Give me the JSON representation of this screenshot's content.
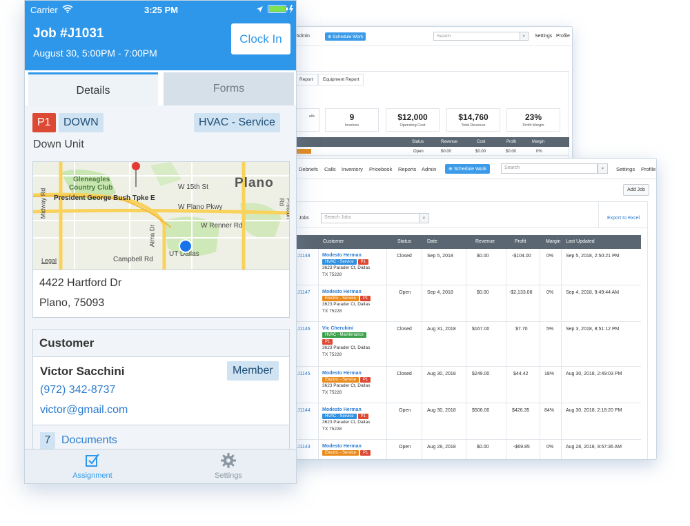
{
  "phone": {
    "status_bar": {
      "carrier": "Carrier",
      "time": "3:25 PM"
    },
    "job": {
      "title": "Job #J1031",
      "time": "August 30, 5:00PM - 7:00PM"
    },
    "clock_in_label": "Clock In",
    "tabs": [
      {
        "label": "Details",
        "active": true
      },
      {
        "label": "Forms",
        "active": false
      }
    ],
    "badges": {
      "priority": "P1",
      "state": "DOWN",
      "service": "HVAC - Service"
    },
    "summary": "Down Unit",
    "map": {
      "labels": {
        "gleneagles": "Gleneagles",
        "country_club": "Country Club",
        "w15": "W 15th St",
        "plano": "Plano",
        "bush": "President George Bush Tpke E",
        "wplano": "W Plano Pkwy",
        "renner": "W Renner Rd",
        "campbell": "Campbell Rd",
        "utd": "UT Dallas",
        "midway": "Midway Rd",
        "preston": "Preston Rd",
        "alma": "Alma Dr",
        "legal": "Legal"
      }
    },
    "address": {
      "line1": "4422 Hartford Dr",
      "line2": "Plano, 75093"
    },
    "customer": {
      "heading": "Customer",
      "name": "Victor Sacchini",
      "tag": "Member",
      "phone": "(972) 342-8737",
      "email": "victor@gmail.com",
      "documents_count": "7",
      "documents_label": "Documents"
    },
    "tabbar": [
      {
        "label": "Assignment",
        "icon": "checkbox-icon",
        "active": true
      },
      {
        "label": "Settings",
        "icon": "gear-icon",
        "active": false
      }
    ]
  },
  "back_window": {
    "nav": {
      "admin": "Admin",
      "schedule": "Schedule Work",
      "search_placeholder": "Search",
      "settings": "Settings",
      "profile": "Profile"
    },
    "tabs": [
      "Report",
      "Equipment Report"
    ],
    "stats": [
      {
        "value": "",
        "label": "alls"
      },
      {
        "value": "9",
        "label": "Invoices"
      },
      {
        "value": "$12,000",
        "label": "Operating Cost"
      },
      {
        "value": "$14,760",
        "label": "Total Revenue"
      },
      {
        "value": "23%",
        "label": "Profit Margin"
      }
    ],
    "headers": [
      "Status",
      "Revenue",
      "Cost",
      "Profit",
      "Margin"
    ],
    "row": [
      "Open",
      "$0.00",
      "$0.00",
      "$0.00",
      "0%"
    ]
  },
  "front_window": {
    "nav": {
      "debriefs": "Debriefs",
      "calls": "Calls",
      "inventory": "Inventory",
      "pricebook": "Pricebook",
      "reports": "Reports",
      "admin": "Admin",
      "schedule": "Schedule Work",
      "search_placeholder": "Search",
      "settings": "Settings",
      "profile": "Profile"
    },
    "add_job": "Add Job",
    "jobs_label": "Jobs",
    "search_jobs_placeholder": "Search Jobs",
    "export": "Export to Excel",
    "headers": [
      "Customer",
      "Status",
      "Date",
      "Revenue",
      "Profit",
      "Margin",
      "Last Updated"
    ],
    "rows": [
      {
        "id": "J1148",
        "customer": "Modesto Herman",
        "tags": [
          {
            "text": "HVAC - Service",
            "color": "#2f8fe0"
          },
          {
            "text": "P1",
            "color": "#dc4a36"
          }
        ],
        "addr1": "3623 Parader Ct, Dallas",
        "addr2": "TX 75228",
        "status": "Closed",
        "date": "Sep 5, 2018",
        "revenue": "$0.00",
        "profit": "-$104.00",
        "margin": "0%",
        "updated": "Sep 5, 2018, 2:50:21 PM"
      },
      {
        "id": "J1147",
        "customer": "Modesto Herman",
        "tags": [
          {
            "text": "Electric - Service",
            "color": "#e98a1a"
          },
          {
            "text": "P1",
            "color": "#dc4a36"
          }
        ],
        "addr1": "3623 Parader Ct, Dallas",
        "addr2": "TX 75228",
        "status": "Open",
        "date": "Sep 4, 2018",
        "revenue": "$0.00",
        "profit": "-$2,133.08",
        "margin": "0%",
        "updated": "Sep 4, 2018, 9:49:44 AM"
      },
      {
        "id": "J1146",
        "customer": "Vic Cherubini",
        "tags": [
          {
            "text": "HVAC - Maintenance",
            "color": "#3aa14a"
          },
          {
            "text": "P1",
            "color": "#dc4a36"
          }
        ],
        "addr1": "3623 Parader Ct, Dallas",
        "addr2": "TX 75228",
        "status": "Closed",
        "date": "Aug 31, 2018",
        "revenue": "$167.00",
        "profit": "$7.70",
        "margin": "5%",
        "updated": "Sep 3, 2018, 8:51:12 PM"
      },
      {
        "id": "J1145",
        "customer": "Modesto Herman",
        "tags": [
          {
            "text": "Electric - Service",
            "color": "#e98a1a"
          },
          {
            "text": "P1",
            "color": "#dc4a36"
          }
        ],
        "addr1": "3623 Parader Ct, Dallas",
        "addr2": "TX 75228",
        "status": "Closed",
        "date": "Aug 30, 2018",
        "revenue": "$249.00",
        "profit": "$44.42",
        "margin": "18%",
        "updated": "Aug 30, 2018, 2:49:03 PM"
      },
      {
        "id": "J1144",
        "customer": "Modesto Herman",
        "tags": [
          {
            "text": "HVAC - Service",
            "color": "#2f8fe0"
          },
          {
            "text": "P1",
            "color": "#dc4a36"
          }
        ],
        "addr1": "3623 Parader Ct, Dallas",
        "addr2": "TX 75228",
        "status": "Open",
        "date": "Aug 30, 2018",
        "revenue": "$506.00",
        "profit": "$426.35",
        "margin": "84%",
        "updated": "Aug 30, 2018, 2:18:20 PM"
      },
      {
        "id": "J1143",
        "customer": "Modesto Herman",
        "tags": [
          {
            "text": "Electric - Service",
            "color": "#e98a1a"
          },
          {
            "text": "P1",
            "color": "#dc4a36"
          }
        ],
        "addr1": "",
        "addr2": "",
        "status": "Open",
        "date": "Aug 28, 2018",
        "revenue": "$0.00",
        "profit": "-$69.85",
        "margin": "0%",
        "updated": "Aug 28, 2018, 9:57:36 AM"
      }
    ]
  },
  "colors": {
    "brand_blue": "#2e97ea",
    "header_gray": "#5a6671",
    "priority_red": "#dc4a36"
  }
}
